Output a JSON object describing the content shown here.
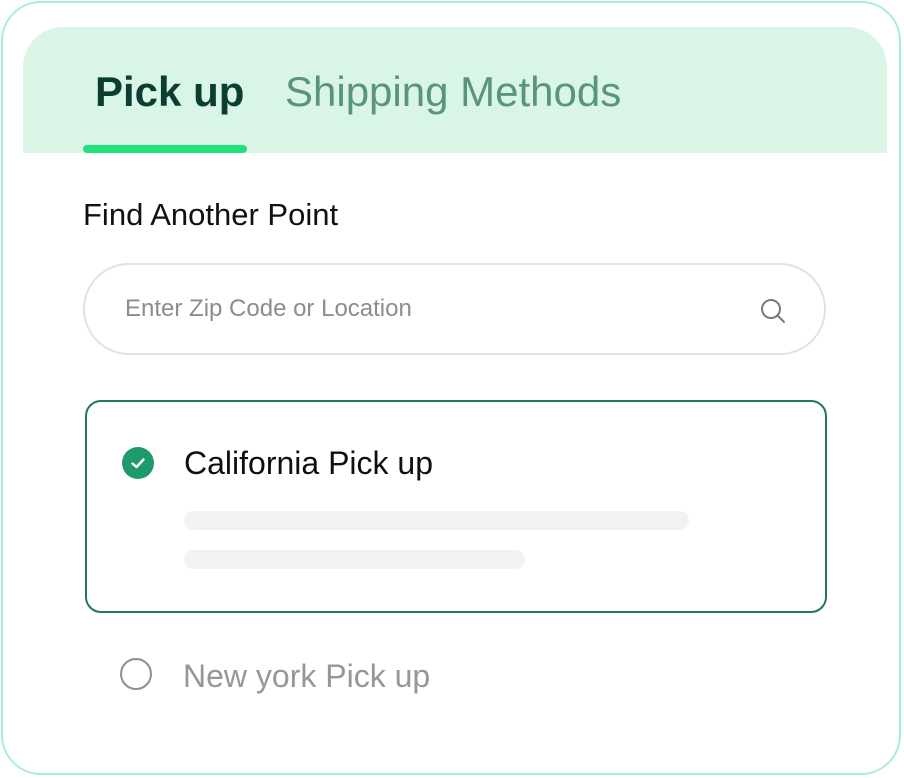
{
  "tabs": [
    {
      "label": "Pick up",
      "active": true
    },
    {
      "label": "Shipping Methods",
      "active": false
    }
  ],
  "section": {
    "title": "Find Another Point"
  },
  "search": {
    "placeholder": "Enter Zip Code or Location",
    "value": "",
    "icon": "search-icon"
  },
  "locations": [
    {
      "label": "California Pick up",
      "selected": true
    },
    {
      "label": "New york Pick up",
      "selected": false
    }
  ],
  "colors": {
    "accent": "#1fe27a",
    "tab_background": "#d8f5e6",
    "active_tab_text": "#0b3d33",
    "inactive_tab_text": "#5a9479",
    "selected_border": "#1f7a5a",
    "check_fill": "#1f9a6a",
    "card_border": "#a9ecd3"
  }
}
